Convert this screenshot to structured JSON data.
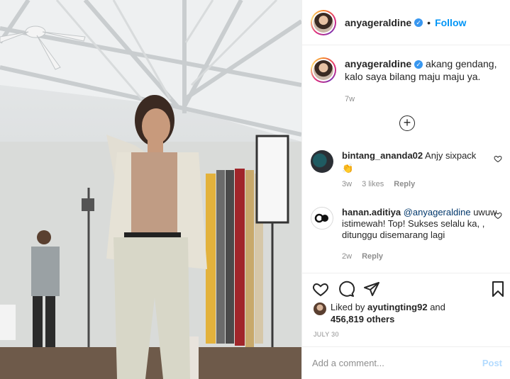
{
  "post": {
    "username": "anyageraldine",
    "follow_label": "Follow",
    "separator": "•",
    "verified_icon": "verified-badge-icon"
  },
  "caption": {
    "username": "anyageraldine",
    "text": "akang gendang, kalo saya bilang maju maju ya.",
    "time": "7w"
  },
  "comments": [
    {
      "username": "bintang_ananda02",
      "text": "Anjy sixpack",
      "emoji": "👏",
      "time": "3w",
      "likes": "3 likes",
      "reply_label": "Reply"
    },
    {
      "username": "hanan.aditiya",
      "mention": "@anyageraldine",
      "text": "uwuw istimewah! Top! Sukses selalu ka, , ditunggu disemarang lagi",
      "time": "2w",
      "reply_label": "Reply"
    }
  ],
  "likes": {
    "prefix": "Liked by",
    "user": "ayutingting92",
    "and": "and",
    "others": "456,819 others"
  },
  "date": "JULY 30",
  "add_comment": {
    "placeholder": "Add a comment...",
    "post_label": "Post"
  },
  "colors": {
    "accent": "#0095f6",
    "muted": "#8e8e8e",
    "text": "#262626",
    "post_disabled": "#b3dbff"
  }
}
